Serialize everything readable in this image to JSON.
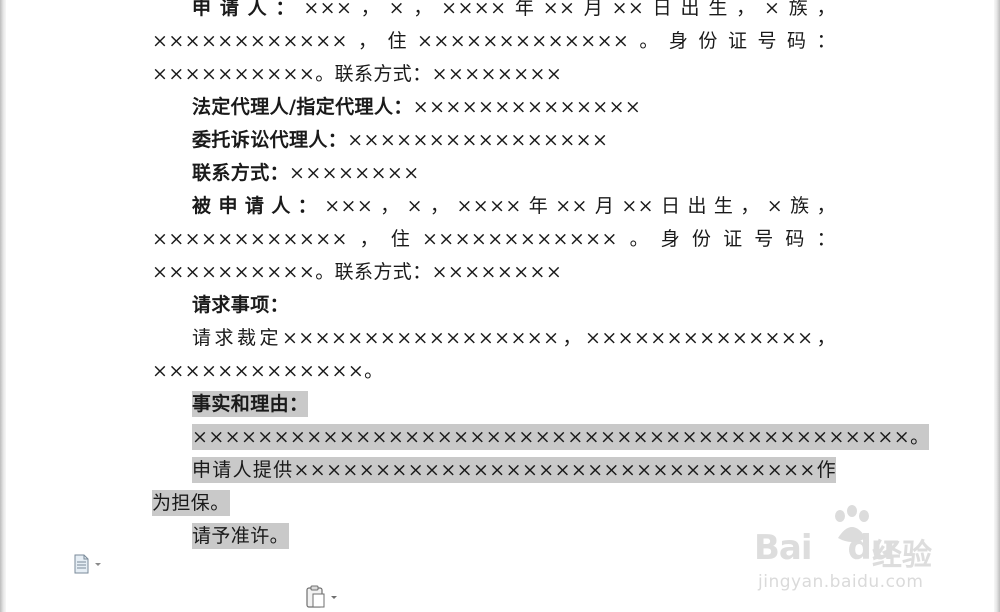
{
  "document": {
    "paragraphs": [
      {
        "label": "申请人：",
        "text": "×××，×，××××年××月××日出生，×族，××××××××××××，住×××××××××××××。身份证号码：××××××××××。联系方式：××××××××"
      },
      {
        "label": "法定代理人/指定代理人：",
        "text": "××××××××××××××"
      },
      {
        "label": "委托诉讼代理人：",
        "text": "××××××××××××××××"
      },
      {
        "label": "联系方式：",
        "text": "××××××××"
      },
      {
        "label": "被申请人：",
        "text": "×××，×，××××年××月××日出生，×族，××××××××××××，住××××××××××××。身份证号码：××××××××××。联系方式：××××××××"
      },
      {
        "label": "请求事项：",
        "text": ""
      },
      {
        "label": "",
        "text": "请求裁定×××××××××××××××××，××××××××××××××，×××××××××××××。"
      },
      {
        "label": "事实和理由：",
        "text": ""
      },
      {
        "label": "",
        "text": "××××××××××××××××××××××××××××××××××××××××××××。"
      },
      {
        "label": "",
        "text": "申请人提供××××××××××××××××××××××××××××××××作为担保。"
      },
      {
        "label": "",
        "text": "请予准许。"
      }
    ]
  },
  "icons": {
    "document_icon": "paste-document-icon",
    "paste_options_icon": "paste-options-icon"
  },
  "watermark": {
    "brand": "Bai",
    "brand2": "du",
    "suffix": "经验",
    "url": "jingyan.baidu.com"
  }
}
